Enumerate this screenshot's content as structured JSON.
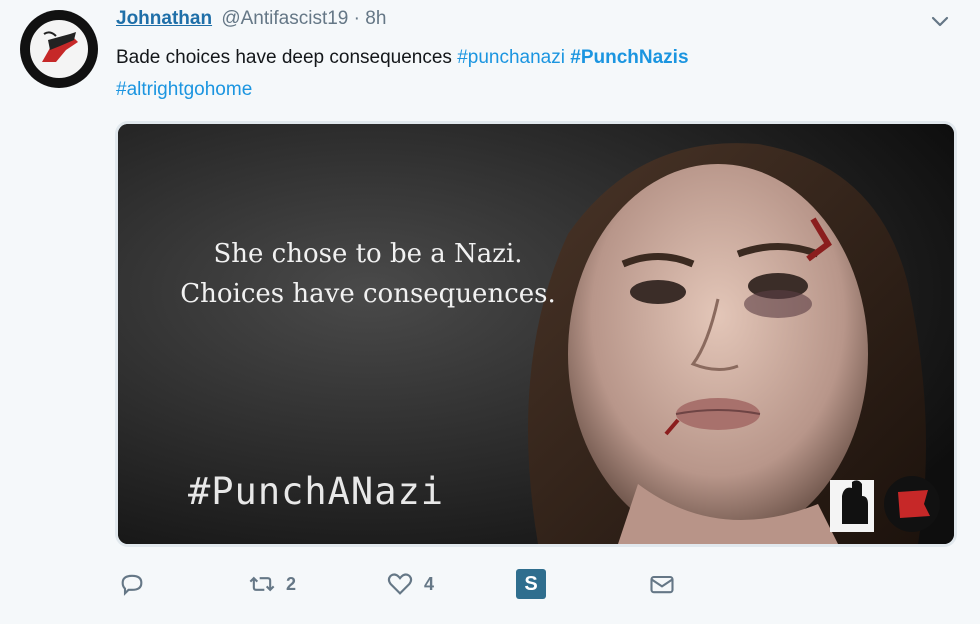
{
  "tweet": {
    "author_name": "Johnathan",
    "author_handle": "@Antifascist19",
    "separator": "·",
    "time": "8h",
    "text_plain": "Bade choices have deep consequences ",
    "hashtags": [
      "#punchanazi",
      "#PunchNazis",
      "#altrightgohome"
    ],
    "media": {
      "caption_line1": "She chose to be a Nazi.",
      "caption_line2": "Choices have consequences.",
      "hashtag": "#PunchANazi"
    },
    "actions": {
      "reply_icon": "reply-icon",
      "retweet_icon": "retweet-icon",
      "retweet_count": "2",
      "like_icon": "heart-icon",
      "like_count": "4",
      "extension_icon": "s-extension-icon",
      "extension_label": "S",
      "message_icon": "envelope-icon"
    },
    "menu_icon": "chevron-down-icon"
  },
  "colors": {
    "name": "#1f6fa8",
    "hashtag": "#1b95e0",
    "muted": "#657786",
    "background": "#f5f8fa"
  }
}
